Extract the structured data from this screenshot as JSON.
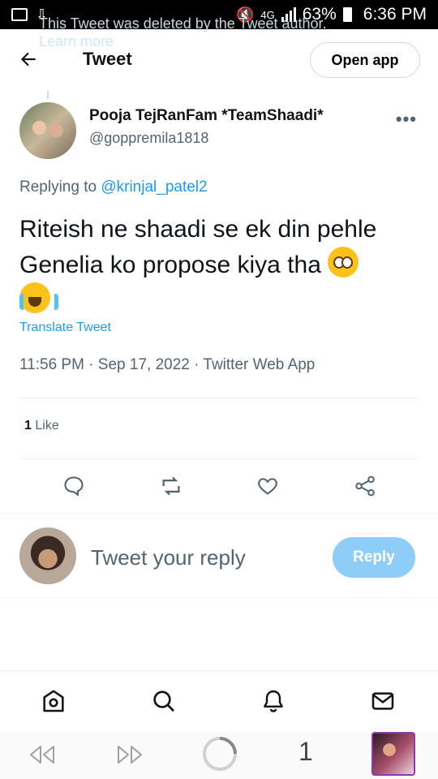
{
  "status_bar": {
    "network": "4G",
    "battery": "63%",
    "time": "6:36 PM"
  },
  "ghost_text": {
    "line1": "This Tweet was deleted by the Tweet author.",
    "line2": "Learn more"
  },
  "header": {
    "title": "Tweet",
    "open_app_label": "Open app"
  },
  "tweet": {
    "author_name": "Pooja TejRanFam *TeamShaadi*",
    "author_handle": "@goppremila1818",
    "more_label": "•••",
    "replying_prefix": "Replying to",
    "replying_handle": "@krinjal_patel2",
    "text_line1": "Riteish ne shaadi se ek din pehle",
    "text_line2": "Genelia ko propose kiya tha",
    "emojis": [
      "pleading-face",
      "loudly-crying-face"
    ],
    "translate_label": "Translate Tweet",
    "timestamp": "11:56 PM · Sep 17, 2022 · Twitter Web App",
    "like_count": "1",
    "like_label": "Like"
  },
  "reply_box": {
    "placeholder": "Tweet your reply",
    "button_label": "Reply"
  },
  "browser_bar": {
    "tab_count": "1"
  },
  "colors": {
    "accent": "#1d9bf0",
    "reply_button": "#8ecdf8",
    "secondary_text": "#536471"
  }
}
